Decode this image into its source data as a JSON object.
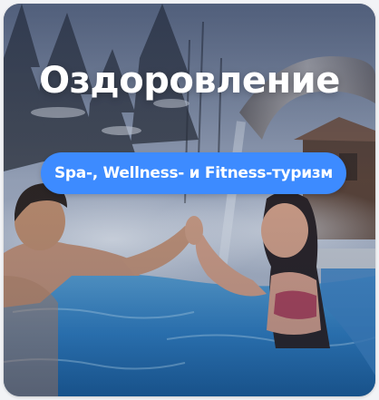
{
  "card": {
    "title": "Оздоровление",
    "tag": "Spa-, Wellness- и Fitness-туризм"
  },
  "colors": {
    "tag_background": "#3d8bff",
    "title_text": "#ffffff",
    "pool_water": "#2f7fc4",
    "sky": "#9aa8c0"
  },
  "image": {
    "subject": "couple-in-outdoor-thermal-pool-icon"
  }
}
